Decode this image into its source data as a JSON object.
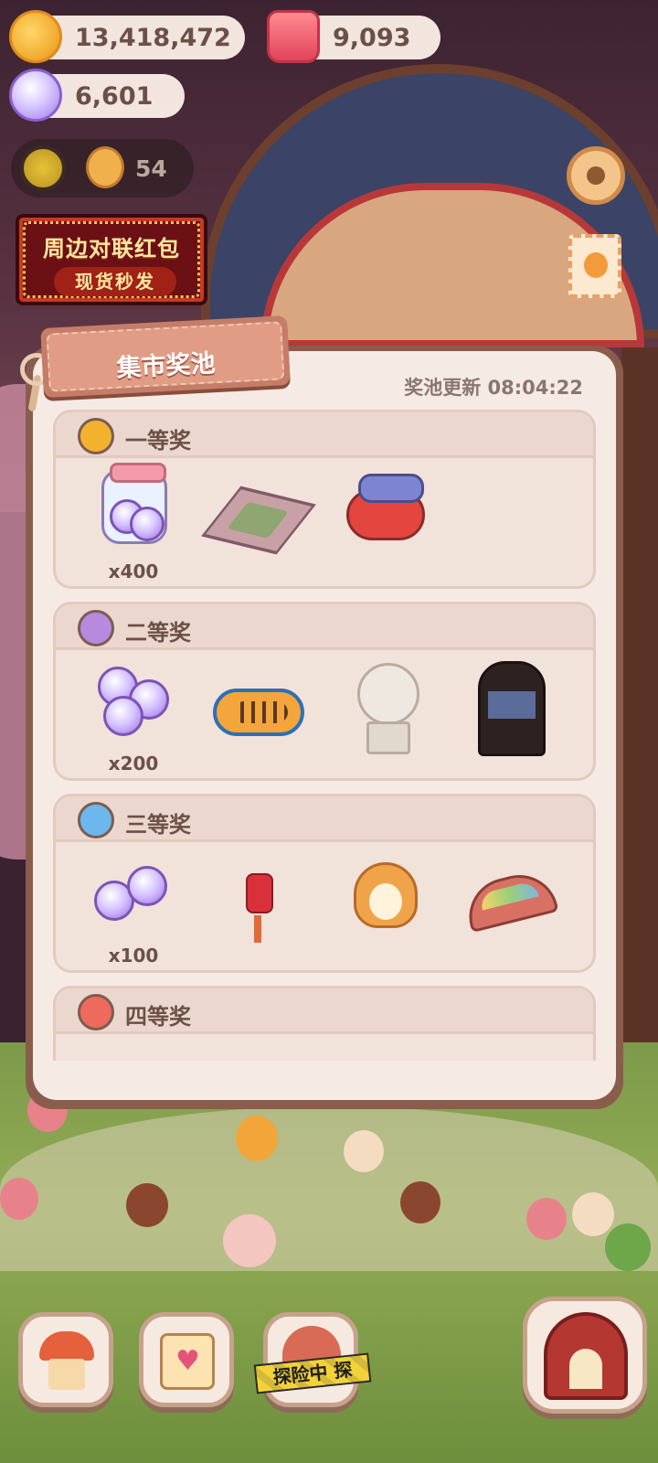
{
  "hud": {
    "gold": "13,418,472",
    "candles": "9,093",
    "gems": "6,601",
    "level_count": "54"
  },
  "promo": {
    "line1": "周边对联红包",
    "line2": "现货秒发"
  },
  "prize_pool": {
    "title": "集市奖池",
    "refresh_text": "奖池更新 08:04:22",
    "tiers": [
      {
        "label": "一等奖",
        "orb_color": "#f2b22e",
        "items": [
          {
            "name": "gem-jar",
            "qty": "x400"
          },
          {
            "name": "patterned-rug",
            "qty": ""
          },
          {
            "name": "toy-plane",
            "qty": ""
          }
        ]
      },
      {
        "label": "二等奖",
        "orb_color": "#b78ae0",
        "items": [
          {
            "name": "gem-cluster",
            "qty": "x200"
          },
          {
            "name": "tiger-rug",
            "qty": ""
          },
          {
            "name": "poodle-statue",
            "qty": ""
          },
          {
            "name": "round-bookshelf",
            "qty": ""
          }
        ]
      },
      {
        "label": "三等奖",
        "orb_color": "#6cb8ee",
        "items": [
          {
            "name": "gem-pair",
            "qty": "x100"
          },
          {
            "name": "chinese-knot",
            "qty": ""
          },
          {
            "name": "corgi-bread",
            "qty": ""
          },
          {
            "name": "rainbow-fan",
            "qty": ""
          }
        ]
      },
      {
        "label": "四等奖",
        "orb_color": "#ee6a5c",
        "items": []
      }
    ]
  },
  "nav": {
    "explore_tape": "探险中 探"
  },
  "colors": {
    "panel_border": "#8a5c4c",
    "panel_bg": "#f6ebe4",
    "text_brown": "#6b5048"
  }
}
